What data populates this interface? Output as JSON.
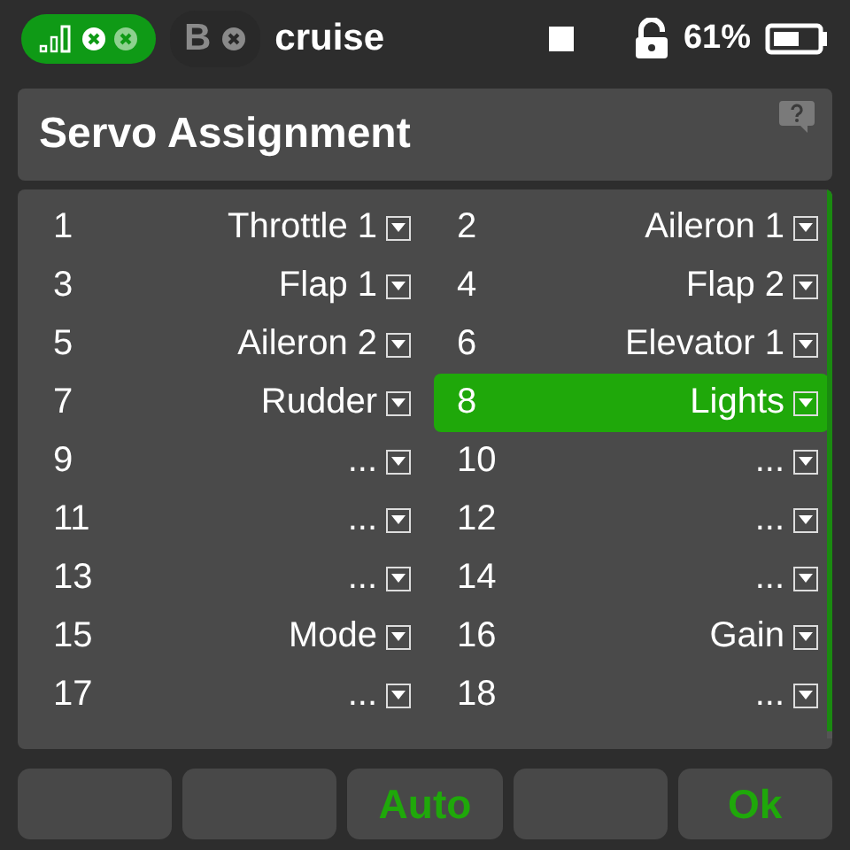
{
  "status_bar": {
    "receiver": "B",
    "model": "cruise",
    "battery": "61%"
  },
  "title": "Servo Assignment",
  "channels": [
    {
      "number": "1",
      "function": "Throttle 1",
      "selected": false
    },
    {
      "number": "2",
      "function": "Aileron 1",
      "selected": false
    },
    {
      "number": "3",
      "function": "Flap 1",
      "selected": false
    },
    {
      "number": "4",
      "function": "Flap 2",
      "selected": false
    },
    {
      "number": "5",
      "function": "Aileron 2",
      "selected": false
    },
    {
      "number": "6",
      "function": "Elevator 1",
      "selected": false
    },
    {
      "number": "7",
      "function": "Rudder",
      "selected": false
    },
    {
      "number": "8",
      "function": "Lights",
      "selected": true
    },
    {
      "number": "9",
      "function": "...",
      "selected": false
    },
    {
      "number": "10",
      "function": "...",
      "selected": false
    },
    {
      "number": "11",
      "function": "...",
      "selected": false
    },
    {
      "number": "12",
      "function": "...",
      "selected": false
    },
    {
      "number": "13",
      "function": "...",
      "selected": false
    },
    {
      "number": "14",
      "function": "...",
      "selected": false
    },
    {
      "number": "15",
      "function": "Mode",
      "selected": false
    },
    {
      "number": "16",
      "function": "Gain",
      "selected": false
    },
    {
      "number": "17",
      "function": "...",
      "selected": false
    },
    {
      "number": "18",
      "function": "...",
      "selected": false
    }
  ],
  "buttons": [
    {
      "kind": "blank"
    },
    {
      "kind": "blank"
    },
    {
      "kind": "action",
      "label": "Auto"
    },
    {
      "kind": "blank"
    },
    {
      "kind": "action",
      "label": "Ok"
    }
  ]
}
